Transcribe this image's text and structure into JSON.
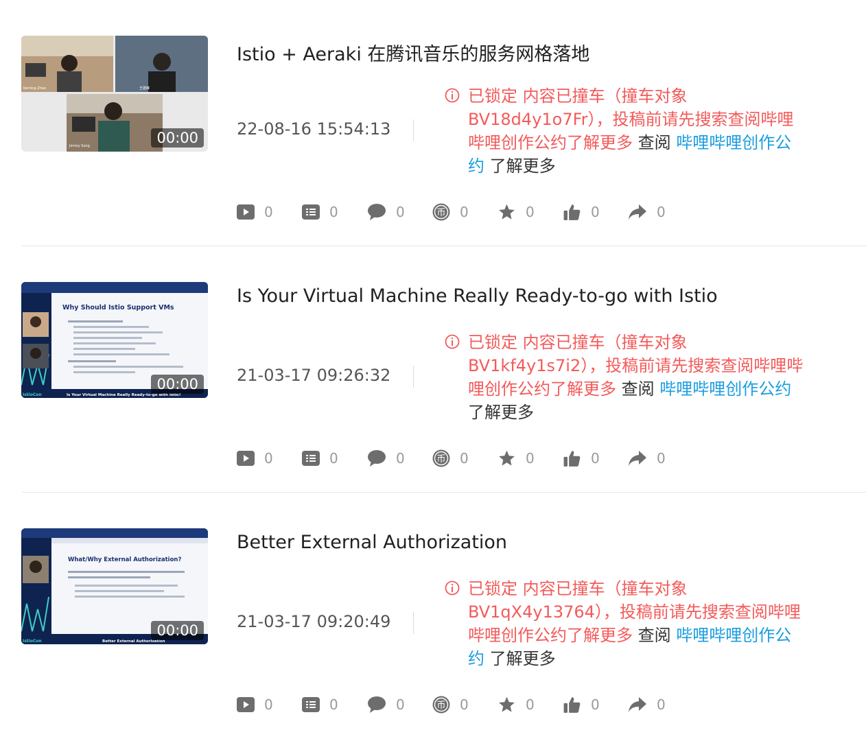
{
  "videos": [
    {
      "title": "Istio + Aeraki 在腾讯音乐的服务网格落地",
      "duration": "00:00",
      "time": "22-08-16 15:54:13",
      "notice": {
        "prefix": "已锁定 内容已撞车（撞车对象 BV18d4y1o7Fr），投稿前请先搜索查阅哔哩哔哩创作公约了解更多",
        "mid": " 查阅 ",
        "link": "哔哩哔哩创作公约",
        "suffix": " 了解更多"
      },
      "thumb_labels": [
        "Keming Zhao",
        "王建峰",
        "Jimmy Song"
      ],
      "stats": {
        "play": "0",
        "danmaku": "0",
        "comment": "0",
        "coin": "0",
        "favorite": "0",
        "like": "0",
        "share": "0"
      }
    },
    {
      "title": "Is Your Virtual Machine Really Ready-to-go with Istio",
      "duration": "00:00",
      "time": "21-03-17 09:26:32",
      "notice": {
        "prefix": "已锁定 内容已撞车（撞车对象 BV1kf4y1s7i2），投稿前请先搜索查阅哔哩哔哩创作公约了解更多",
        "mid": " 查阅 ",
        "link": "哔哩哔哩创作公约",
        "suffix": " 了解更多"
      },
      "thumb_labels": [
        "Why Should Istio Support VMs",
        "IstioCon",
        "Is Your Virtual Machine Really Ready-to-go with Istio?"
      ],
      "stats": {
        "play": "0",
        "danmaku": "0",
        "comment": "0",
        "coin": "0",
        "favorite": "0",
        "like": "0",
        "share": "0"
      }
    },
    {
      "title": "Better External Authorization",
      "duration": "00:00",
      "time": "21-03-17 09:20:49",
      "notice": {
        "prefix": "已锁定 内容已撞车（撞车对象 BV1qX4y13764），投稿前请先搜索查阅哔哩哔哩创作公约了解更多",
        "mid": " 查阅 ",
        "link": "哔哩哔哩创作公约",
        "suffix": " 了解更多"
      },
      "thumb_labels": [
        "What/Why External Authorization?",
        "IstioCon",
        "Better External Authorization"
      ],
      "stats": {
        "play": "0",
        "danmaku": "0",
        "comment": "0",
        "coin": "0",
        "favorite": "0",
        "like": "0",
        "share": "0"
      }
    }
  ],
  "icons": {
    "play": "play-count-icon",
    "danmaku": "danmaku-icon",
    "comment": "comment-icon",
    "coin": "coin-icon",
    "favorite": "star-icon",
    "like": "thumbs-up-icon",
    "share": "share-icon",
    "notice": "info-circle-icon"
  },
  "colors": {
    "notice_red": "#f45a5a",
    "link_blue": "#1a9de0",
    "icon_gray": "#6d6d6d",
    "stat_gray": "#999999"
  }
}
